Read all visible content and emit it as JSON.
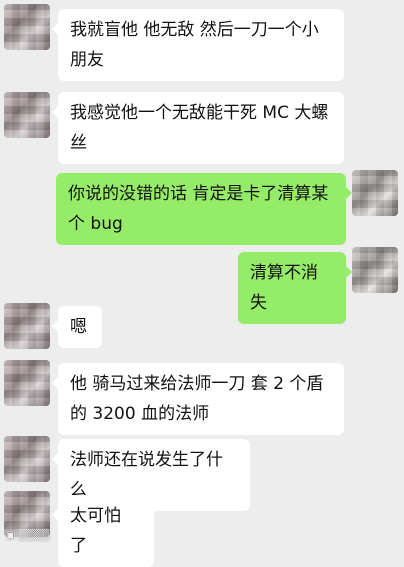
{
  "messages": [
    {
      "side": "in",
      "text": "我就盲他 他无敌 然后一刀一个小朋友"
    },
    {
      "side": "in",
      "text": "我感觉他一个无敌能干死 MC 大螺丝"
    },
    {
      "side": "out",
      "text": "你说的没错的话 肯定是卡了清算某个 bug"
    },
    {
      "side": "out",
      "text": "清算不消失"
    },
    {
      "side": "in",
      "text": "嗯"
    },
    {
      "side": "in",
      "text": "他  骑马过来给法师一刀    套 2 个盾的 3200 血的法师"
    },
    {
      "side": "in",
      "text": "法师还在说发生了什么"
    },
    {
      "side": "in",
      "text": "太可怕 了"
    }
  ],
  "colors": {
    "background": "#ededed",
    "incoming_bubble": "#ffffff",
    "outgoing_bubble": "#95ec69"
  }
}
